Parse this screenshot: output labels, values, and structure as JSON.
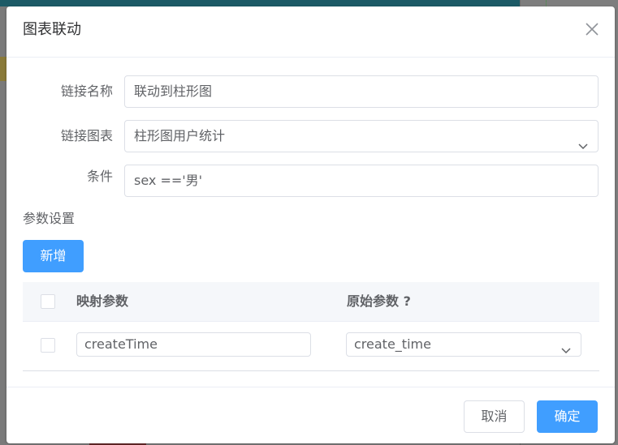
{
  "dialog": {
    "title": "图表联动",
    "close_icon": "close-icon"
  },
  "form": {
    "link_name": {
      "label": "链接名称",
      "value": "联动到柱形图"
    },
    "link_chart": {
      "label": "链接图表",
      "value": "柱形图用户统计",
      "arrow_icon": "chevron-down-icon"
    },
    "condition": {
      "label": "条件",
      "value": "sex =='男'"
    }
  },
  "params": {
    "section_label": "参数设置",
    "add_label": "新增",
    "table": {
      "columns": [
        "映射参数",
        "原始参数 ?"
      ],
      "rows": [
        {
          "mapped": "createTime",
          "original": "create_time"
        }
      ]
    }
  },
  "footer": {
    "cancel_label": "取消",
    "ok_label": "确定"
  },
  "colors": {
    "primary": "#409eff",
    "border": "#dcdfe6",
    "header_bg": "#f5f7fa",
    "text": "#606266",
    "title": "#303133"
  }
}
